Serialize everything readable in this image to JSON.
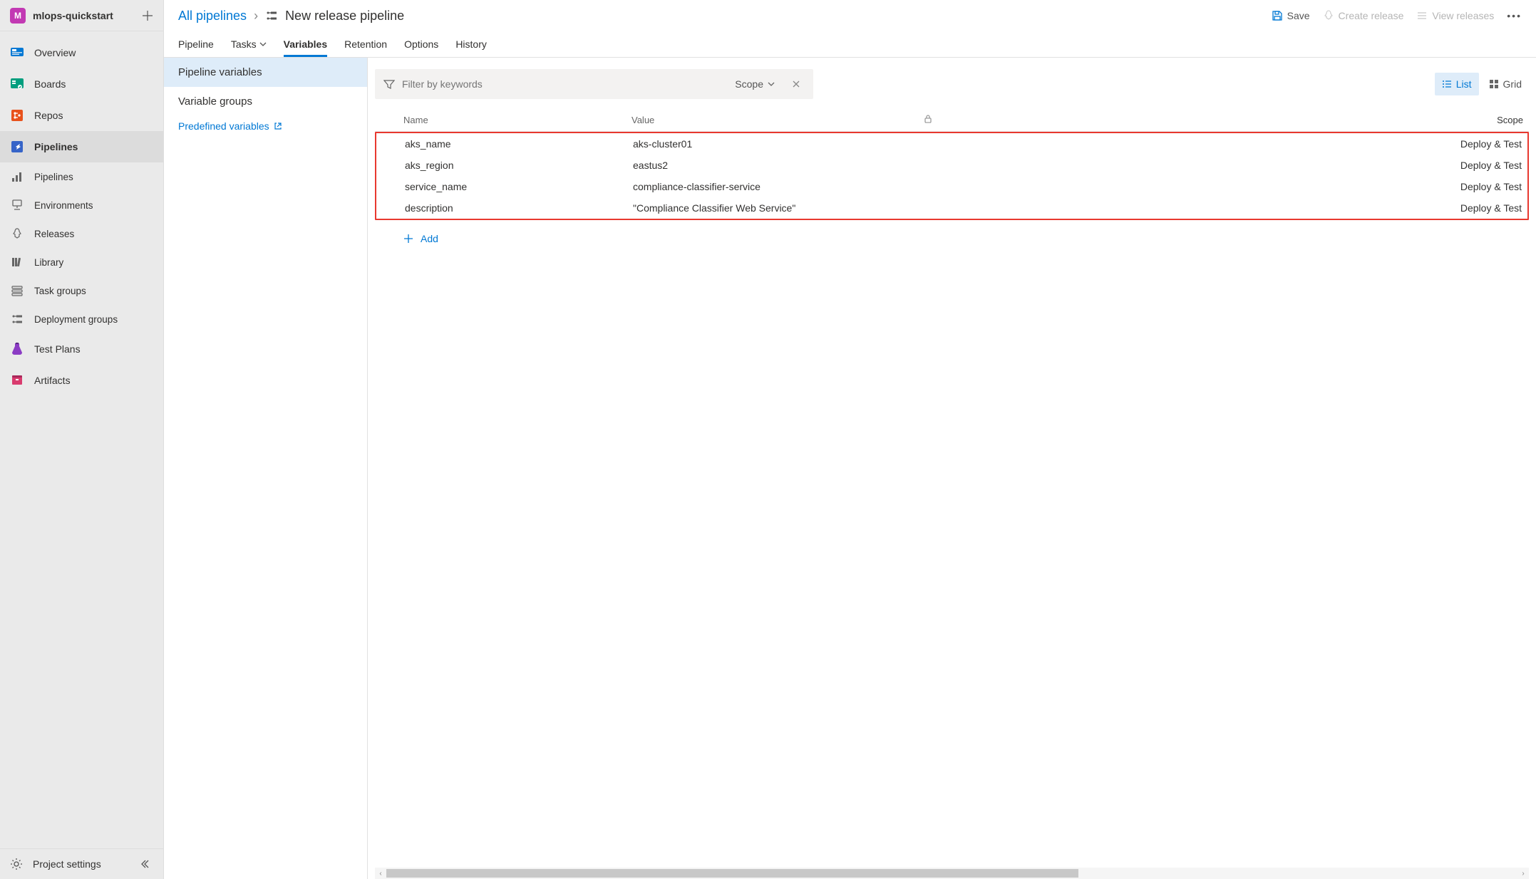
{
  "project": {
    "badge": "M",
    "name": "mlops-quickstart"
  },
  "sidebar": {
    "overview": "Overview",
    "boards": "Boards",
    "repos": "Repos",
    "pipelines": "Pipelines",
    "sub_pipelines": "Pipelines",
    "sub_environments": "Environments",
    "sub_releases": "Releases",
    "sub_library": "Library",
    "sub_taskgroups": "Task groups",
    "sub_deploymentgroups": "Deployment groups",
    "testplans": "Test Plans",
    "artifacts": "Artifacts",
    "project_settings": "Project settings"
  },
  "breadcrumb": {
    "all_pipelines": "All pipelines",
    "title": "New release pipeline"
  },
  "actions": {
    "save": "Save",
    "create_release": "Create release",
    "view_releases": "View releases"
  },
  "tabs": {
    "pipeline": "Pipeline",
    "tasks": "Tasks",
    "variables": "Variables",
    "retention": "Retention",
    "options": "Options",
    "history": "History"
  },
  "var_nav": {
    "pipeline_variables": "Pipeline variables",
    "variable_groups": "Variable groups",
    "predefined": "Predefined variables"
  },
  "filter": {
    "placeholder": "Filter by keywords",
    "scope_label": "Scope"
  },
  "view": {
    "list": "List",
    "grid": "Grid"
  },
  "columns": {
    "name": "Name",
    "value": "Value",
    "scope": "Scope"
  },
  "rows": [
    {
      "name": "aks_name",
      "value": "aks-cluster01",
      "scope": "Deploy & Test"
    },
    {
      "name": "aks_region",
      "value": "eastus2",
      "scope": "Deploy & Test"
    },
    {
      "name": "service_name",
      "value": "compliance-classifier-service",
      "scope": "Deploy & Test"
    },
    {
      "name": "description",
      "value": "\"Compliance Classifier Web Service\"",
      "scope": "Deploy & Test"
    }
  ],
  "add_label": "Add"
}
